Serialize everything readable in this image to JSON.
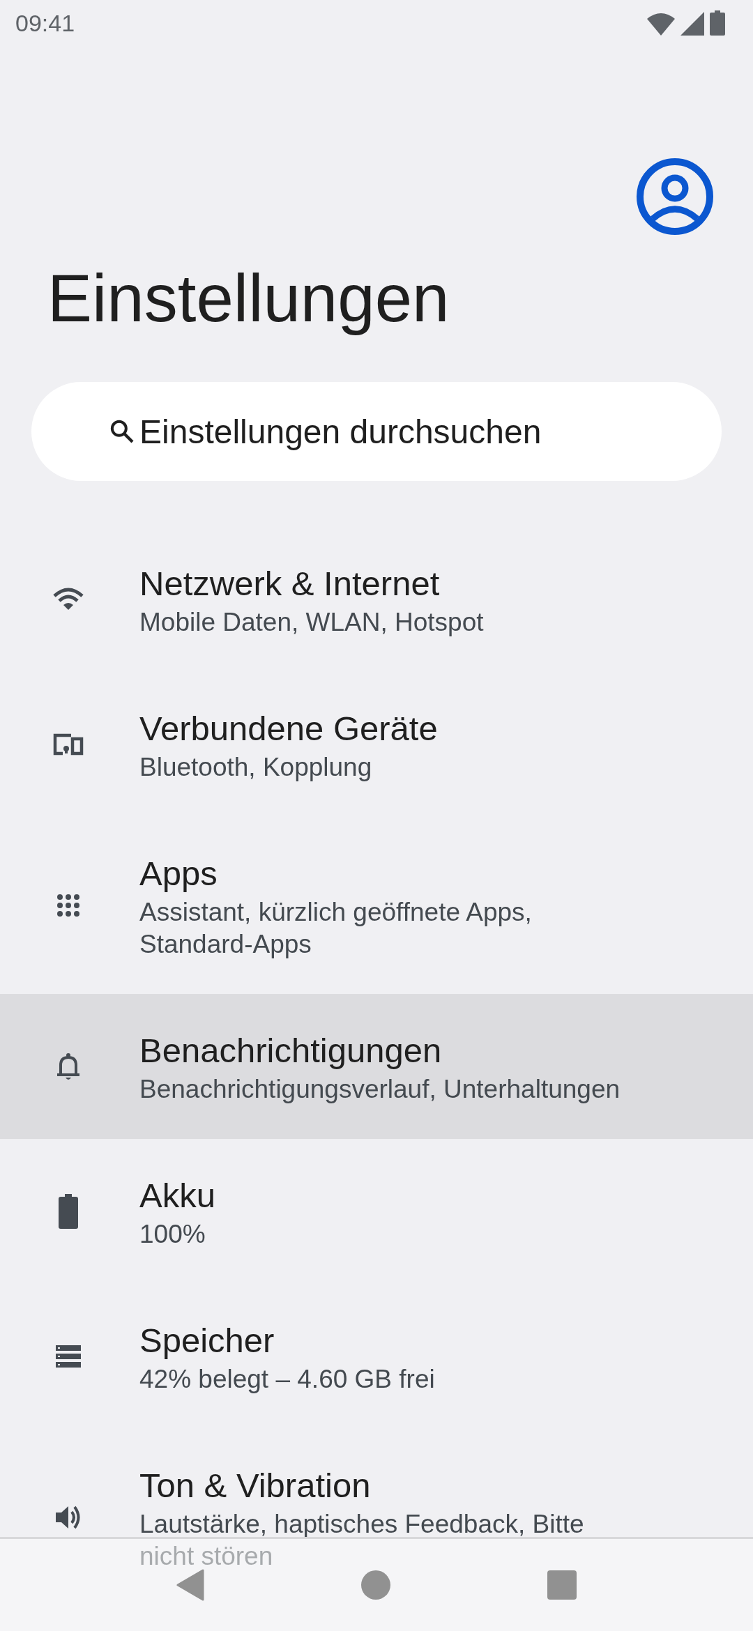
{
  "status_bar": {
    "time": "09:41"
  },
  "title": "Einstellungen",
  "search": {
    "placeholder": "Einstellungen durchsuchen"
  },
  "items": [
    {
      "title": "Netzwerk & Internet",
      "subtitle": "Mobile Daten, WLAN, Hotspot",
      "selected": false
    },
    {
      "title": "Verbundene Geräte",
      "subtitle": "Bluetooth, Kopplung",
      "selected": false
    },
    {
      "title": "Apps",
      "subtitle": "Assistant, kürzlich geöffnete Apps, Standard-Apps",
      "selected": false
    },
    {
      "title": "Benachrichtigungen",
      "subtitle": "Benachrichtigungsverlauf, Unterhaltungen",
      "selected": true
    },
    {
      "title": "Akku",
      "subtitle": "100%",
      "selected": false
    },
    {
      "title": "Speicher",
      "subtitle": "42% belegt – 4.60 GB frei",
      "selected": false
    },
    {
      "title": "Ton & Vibration",
      "subtitle": "Lautstärke, haptisches Feedback, Bitte nicht stören",
      "selected": false
    }
  ]
}
